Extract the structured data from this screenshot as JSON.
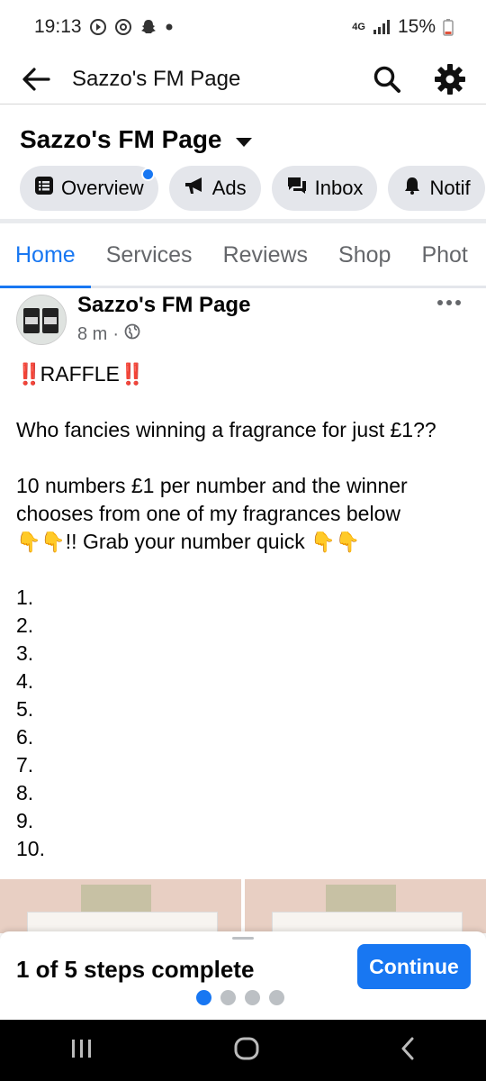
{
  "status_bar": {
    "time": "19:13",
    "network": "4G",
    "battery": "15%"
  },
  "app_bar": {
    "title": "Sazzo's FM Page",
    "icons": [
      "back-arrow-icon",
      "search-icon",
      "gear-icon"
    ]
  },
  "page_header": {
    "name": "Sazzo's FM Page",
    "chips": [
      {
        "label": "Overview",
        "icon": "overview-icon",
        "badge": true
      },
      {
        "label": "Ads",
        "icon": "megaphone-icon"
      },
      {
        "label": "Inbox",
        "icon": "chat-icon"
      },
      {
        "label": "Notif",
        "icon": "bell-icon"
      }
    ]
  },
  "tabs": [
    {
      "label": "Home",
      "active": true
    },
    {
      "label": "Services"
    },
    {
      "label": "Reviews"
    },
    {
      "label": "Shop"
    },
    {
      "label": "Phot"
    }
  ],
  "post": {
    "author": "Sazzo's FM Page",
    "time": "8 m",
    "headline_emoji": "‼️",
    "headline": "RAFFLE",
    "line1": "Who fancies winning a fragrance for just £1??",
    "line2a": "10 numbers £1 per number and the winner chooses from one of my fragrances below",
    "line2b": "!! Grab your number quick",
    "numbers": [
      "1.",
      "2.",
      "3.",
      "4.",
      "5.",
      "6.",
      "7.",
      "8.",
      "9.",
      "10."
    ]
  },
  "onboarding": {
    "steps_text": "1 of 5 steps complete",
    "button": "Continue",
    "progress": {
      "current": 1,
      "total": 4
    }
  },
  "nav_bar": {
    "icons": [
      "recent-apps-icon",
      "home-icon",
      "back-icon"
    ]
  },
  "colors": {
    "accent": "#1877f2",
    "chip_bg": "#e4e6eb",
    "raffle_emoji": "#e0132b"
  }
}
